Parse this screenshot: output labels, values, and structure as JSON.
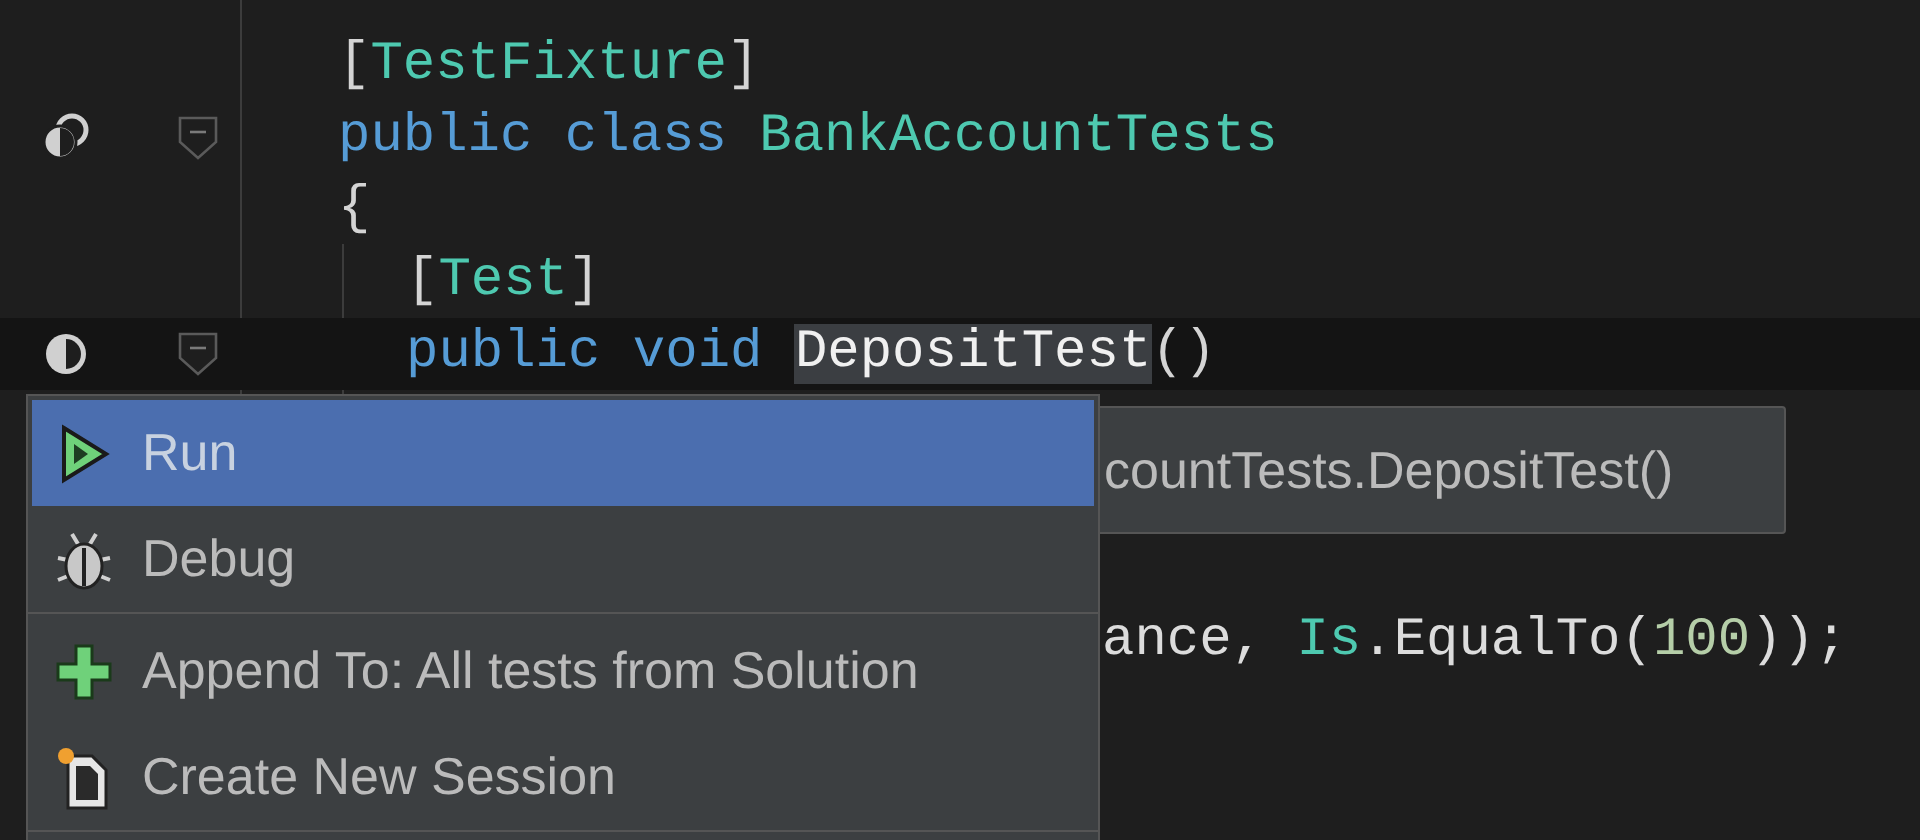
{
  "editor": {
    "lines": [
      {
        "fold": false,
        "current": false,
        "indented": false,
        "clipped": false,
        "tokens": [
          {
            "text": "[",
            "kind": "punct"
          },
          {
            "text": "TestFixture",
            "kind": "type"
          },
          {
            "text": "]",
            "kind": "punct"
          }
        ]
      },
      {
        "marker": {
          "kind": "tests"
        },
        "fold": true,
        "current": false,
        "indented": false,
        "clipped": false,
        "tokens": [
          {
            "text": "public ",
            "kind": "keyword"
          },
          {
            "text": "class ",
            "kind": "keyword"
          },
          {
            "text": "BankAccountTests",
            "kind": "type"
          }
        ]
      },
      {
        "fold": false,
        "current": false,
        "indented": false,
        "clipped": false,
        "tokens": [
          {
            "text": "{",
            "kind": "punct"
          }
        ]
      },
      {
        "fold": false,
        "current": false,
        "indented": true,
        "clipped": false,
        "tokens": [
          {
            "text": "[",
            "kind": "punct"
          },
          {
            "text": "Test",
            "kind": "type"
          },
          {
            "text": "]",
            "kind": "punct"
          }
        ]
      },
      {
        "marker": {
          "kind": "test"
        },
        "fold": true,
        "current": true,
        "indented": true,
        "clipped": false,
        "tokens": [
          {
            "text": "public ",
            "kind": "keyword"
          },
          {
            "text": "void ",
            "kind": "keyword"
          },
          {
            "text": "DepositTest",
            "kind": "highlight"
          },
          {
            "text": "()",
            "kind": "punct"
          }
        ]
      },
      {
        "fold": false,
        "current": false,
        "clipped": true,
        "tokens": [
          {
            "text": "ance, ",
            "kind": "plain"
          },
          {
            "text": "Is",
            "kind": "type"
          },
          {
            "text": ".EqualTo(",
            "kind": "plain"
          },
          {
            "text": "100",
            "kind": "number"
          },
          {
            "text": "));",
            "kind": "plain"
          }
        ]
      }
    ]
  },
  "tooltip": {
    "text": "countTests.DepositTest()"
  },
  "context_menu": {
    "groups": [
      {
        "items": [
          {
            "label": "Run",
            "kind": "run",
            "selected": true
          },
          {
            "label": "Debug",
            "kind": "debug",
            "selected": false
          }
        ]
      },
      {
        "items": [
          {
            "label": "Append To: All tests from Solution",
            "kind": "append",
            "selected": false
          },
          {
            "label": "Create New Session",
            "kind": "session",
            "selected": false
          }
        ]
      }
    ]
  }
}
